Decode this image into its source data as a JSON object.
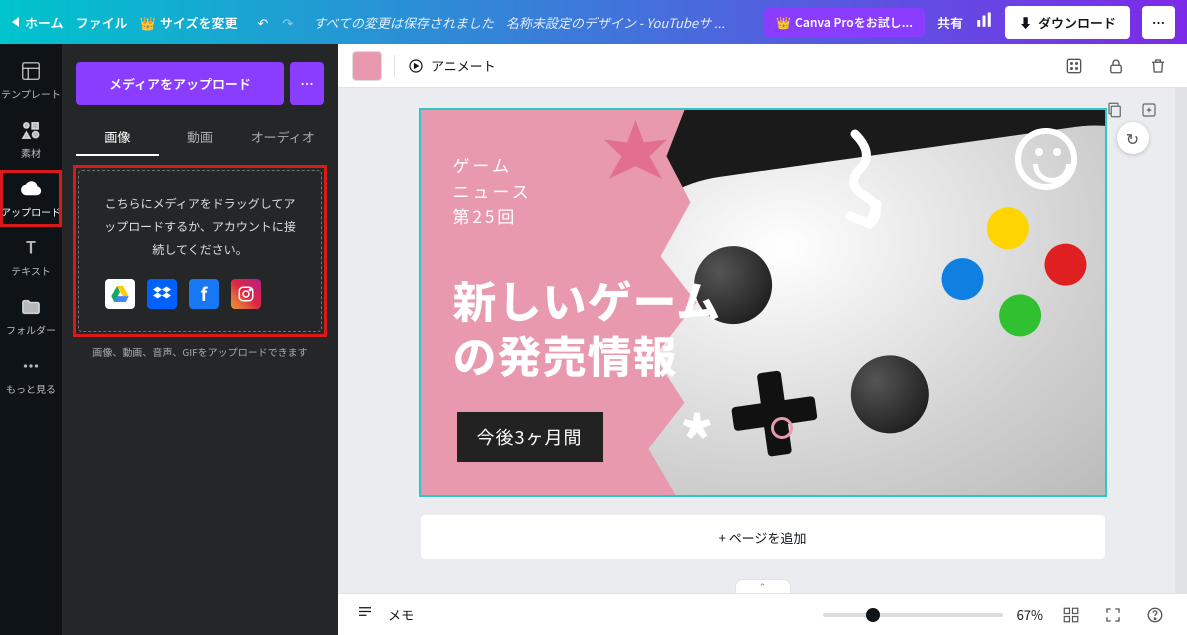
{
  "topbar": {
    "home": "ホーム",
    "file": "ファイル",
    "resize": "サイズを変更",
    "save_status": "すべての変更は保存されました",
    "doc_title": "名称未設定のデザイン - YouTubeサ ...",
    "pro": "Canva Proをお試し...",
    "share": "共有",
    "download": "ダウンロード"
  },
  "iconbar": {
    "template": "テンプレート",
    "elements": "素材",
    "upload": "アップロード",
    "text": "テキスト",
    "folder": "フォルダー",
    "more": "もっと見る"
  },
  "sidepanel": {
    "upload_btn": "メディアをアップロード",
    "tabs": {
      "image": "画像",
      "video": "動画",
      "audio": "オーディオ"
    },
    "drop_text": "こちらにメディアをドラッグしてアップロードするか、アカウントに接続してください。",
    "hint": "画像、動画、音声、GIFをアップロードできます"
  },
  "canvas_toolbar": {
    "animate": "アニメート",
    "color": "#e899ae"
  },
  "design": {
    "subtitle_line1": "ゲーム",
    "subtitle_line2": "ニュース",
    "subtitle_line3": "第25回",
    "title_line1": "新しいゲーム",
    "title_line2": "の発売情報",
    "badge": "今後3ヶ月間"
  },
  "add_page": "+ ページを追加",
  "bottombar": {
    "memo": "メモ",
    "zoom": "67%"
  }
}
